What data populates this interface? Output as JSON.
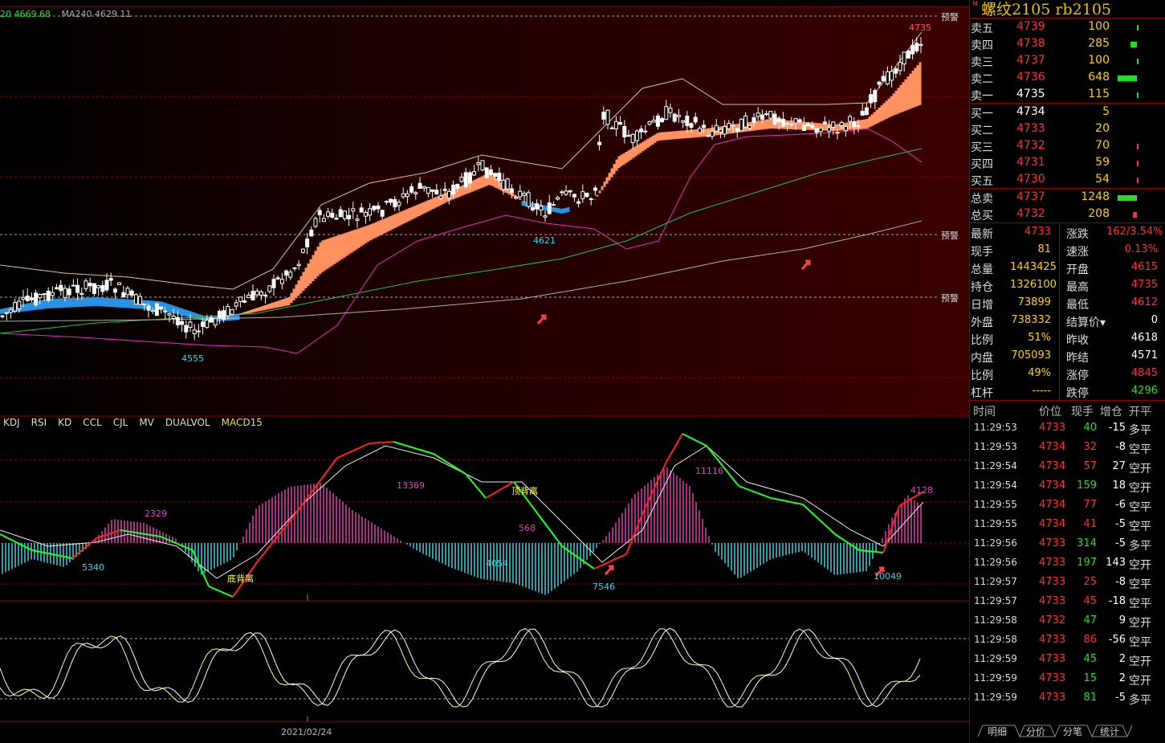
{
  "legend": {
    "ma20": "20 4669.68",
    "ma240": "MA240 4629.11"
  },
  "indicator_tabs": [
    "KDJ",
    "RSI",
    "KD",
    "CCL",
    "CJL",
    "MV",
    "DUALVOL",
    "MACD15"
  ],
  "active_tab": "MACD15",
  "warning_label": "预警",
  "date_label": "2021/02/24",
  "price_annotations": {
    "high": "4735",
    "low1": "4555",
    "low2": "4621"
  },
  "macd_annotations": [
    "2329",
    "5340",
    "底背离",
    "13369",
    "4054",
    "顶背离",
    "568",
    "7546",
    "11116",
    "10049",
    "4128"
  ],
  "colors": {
    "up": "#ff3030",
    "down": "#20e020",
    "accent": "#e8c000",
    "border": "#8a0000"
  },
  "panel": {
    "marker": "M",
    "title": "螺纹2105  rb2105",
    "asks": [
      {
        "label": "卖五",
        "price": "4739",
        "vol": "100",
        "bar": 3
      },
      {
        "label": "卖四",
        "price": "4738",
        "vol": "285",
        "bar": 8
      },
      {
        "label": "卖三",
        "price": "4737",
        "vol": "100",
        "bar": 3
      },
      {
        "label": "卖二",
        "price": "4736",
        "vol": "648",
        "bar": 24
      },
      {
        "label": "卖一",
        "price": "4735",
        "vol": "115",
        "bar": 4
      }
    ],
    "bids": [
      {
        "label": "买一",
        "price": "4734",
        "vol": "5",
        "bar": 0
      },
      {
        "label": "买二",
        "price": "4733",
        "vol": "20",
        "bar": 0
      },
      {
        "label": "买三",
        "price": "4732",
        "vol": "70",
        "bar": 2
      },
      {
        "label": "买四",
        "price": "4731",
        "vol": "59",
        "bar": 2
      },
      {
        "label": "买五",
        "price": "4730",
        "vol": "54",
        "bar": 2
      }
    ],
    "totals": [
      {
        "label": "总卖",
        "price": "4737",
        "vol": "1248",
        "bar": 24,
        "bar_color": "green"
      },
      {
        "label": "总买",
        "price": "4732",
        "vol": "208",
        "bar": 5,
        "bar_color": "red"
      }
    ],
    "stats": [
      {
        "l1": "最新",
        "v1": "4733",
        "c1": "red",
        "l2": "涨跌",
        "v2": "162/3.54%",
        "c2": "red"
      },
      {
        "l1": "现手",
        "v1": "81",
        "c1": "yellow",
        "l2": "速涨",
        "v2": "0.13%",
        "c2": "red"
      },
      {
        "l1": "总量",
        "v1": "1443425",
        "c1": "yellow",
        "l2": "开盘",
        "v2": "4615",
        "c2": "red"
      },
      {
        "l1": "持仓",
        "v1": "1326100",
        "c1": "yellow",
        "l2": "最高",
        "v2": "4735",
        "c2": "red"
      },
      {
        "l1": "日增",
        "v1": "73899",
        "c1": "yellow",
        "l2": "最低",
        "v2": "4612",
        "c2": "red"
      },
      {
        "l1": "外盘",
        "v1": "738332",
        "c1": "yellow",
        "l2": "结算价▾",
        "v2": "0",
        "c2": "white"
      },
      {
        "l1": "比例",
        "v1": "51%",
        "c1": "yellow",
        "l2": "昨收",
        "v2": "4618",
        "c2": "white"
      },
      {
        "l1": "内盘",
        "v1": "705093",
        "c1": "yellow",
        "l2": "昨结",
        "v2": "4571",
        "c2": "white"
      },
      {
        "l1": "比例",
        "v1": "49%",
        "c1": "yellow",
        "l2": "涨停",
        "v2": "4845",
        "c2": "red"
      },
      {
        "l1": "杠杆",
        "v1": "-----",
        "c1": "yellow",
        "l2": "跌停",
        "v2": "4296",
        "c2": "green"
      }
    ],
    "tick_headers": {
      "time": "时间",
      "price": "价位",
      "qty": "现手",
      "oi": "增仓",
      "type": "开平"
    },
    "ticks": [
      {
        "time": "11:29:53",
        "price": "4733",
        "qty": "40",
        "oi": "-15",
        "type": "多平",
        "qc": "green"
      },
      {
        "time": "11:29:53",
        "price": "4734",
        "qty": "32",
        "oi": "-8",
        "type": "空平",
        "qc": "red"
      },
      {
        "time": "11:29:54",
        "price": "4734",
        "qty": "57",
        "oi": "27",
        "type": "空开",
        "qc": "red"
      },
      {
        "time": "11:29:54",
        "price": "4734",
        "qty": "159",
        "oi": "18",
        "type": "空开",
        "qc": "green"
      },
      {
        "time": "11:29:55",
        "price": "4734",
        "qty": "77",
        "oi": "-6",
        "type": "空平",
        "qc": "red"
      },
      {
        "time": "11:29:55",
        "price": "4734",
        "qty": "41",
        "oi": "-5",
        "type": "空平",
        "qc": "red"
      },
      {
        "time": "11:29:56",
        "price": "4733",
        "qty": "314",
        "oi": "-5",
        "type": "多平",
        "qc": "green"
      },
      {
        "time": "11:29:56",
        "price": "4733",
        "qty": "197",
        "oi": "143",
        "type": "空开",
        "qc": "green"
      },
      {
        "time": "11:29:57",
        "price": "4733",
        "qty": "25",
        "oi": "-8",
        "type": "空平",
        "qc": "red"
      },
      {
        "time": "11:29:57",
        "price": "4733",
        "qty": "45",
        "oi": "-18",
        "type": "空平",
        "qc": "red"
      },
      {
        "time": "11:29:58",
        "price": "4732",
        "qty": "47",
        "oi": "9",
        "type": "空开",
        "qc": "green"
      },
      {
        "time": "11:29:58",
        "price": "4733",
        "qty": "86",
        "oi": "-56",
        "type": "空平",
        "qc": "red"
      },
      {
        "time": "11:29:59",
        "price": "4733",
        "qty": "45",
        "oi": "2",
        "type": "空开",
        "qc": "green"
      },
      {
        "time": "11:29:59",
        "price": "4733",
        "qty": "15",
        "oi": "2",
        "type": "空开",
        "qc": "green"
      },
      {
        "time": "11:29:59",
        "price": "4733",
        "qty": "81",
        "oi": "-5",
        "type": "多平",
        "qc": "green"
      }
    ],
    "bottom_tabs": [
      "明细",
      "分价",
      "分笔",
      "统计"
    ]
  }
}
